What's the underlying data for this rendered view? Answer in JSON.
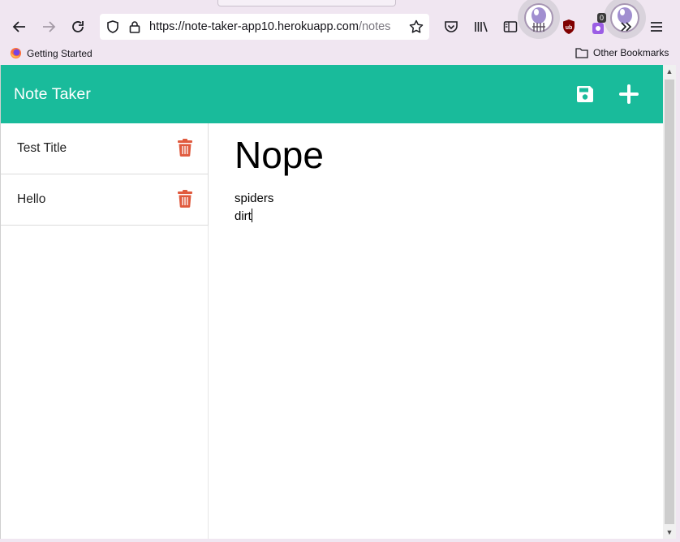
{
  "browser": {
    "url_host": "https://note-taker-app10.herokuapp.com",
    "url_path": "/notes",
    "bookmarks": [
      {
        "label": "Getting Started",
        "icon": "firefox-icon"
      },
      {
        "label": "Other Bookmarks",
        "icon": "folder-icon"
      }
    ],
    "extension_badge": "0"
  },
  "app": {
    "brand": "Note Taker",
    "actions": [
      {
        "name": "save",
        "icon": "save-icon"
      },
      {
        "name": "new-note",
        "icon": "plus-icon"
      }
    ],
    "notes": [
      {
        "title": "Test Title"
      },
      {
        "title": "Hello"
      }
    ],
    "active_note": {
      "title": "Nope",
      "text": "spiders\ndirt"
    }
  },
  "colors": {
    "accent": "#19bb9b",
    "delete": "#e05a3e"
  }
}
